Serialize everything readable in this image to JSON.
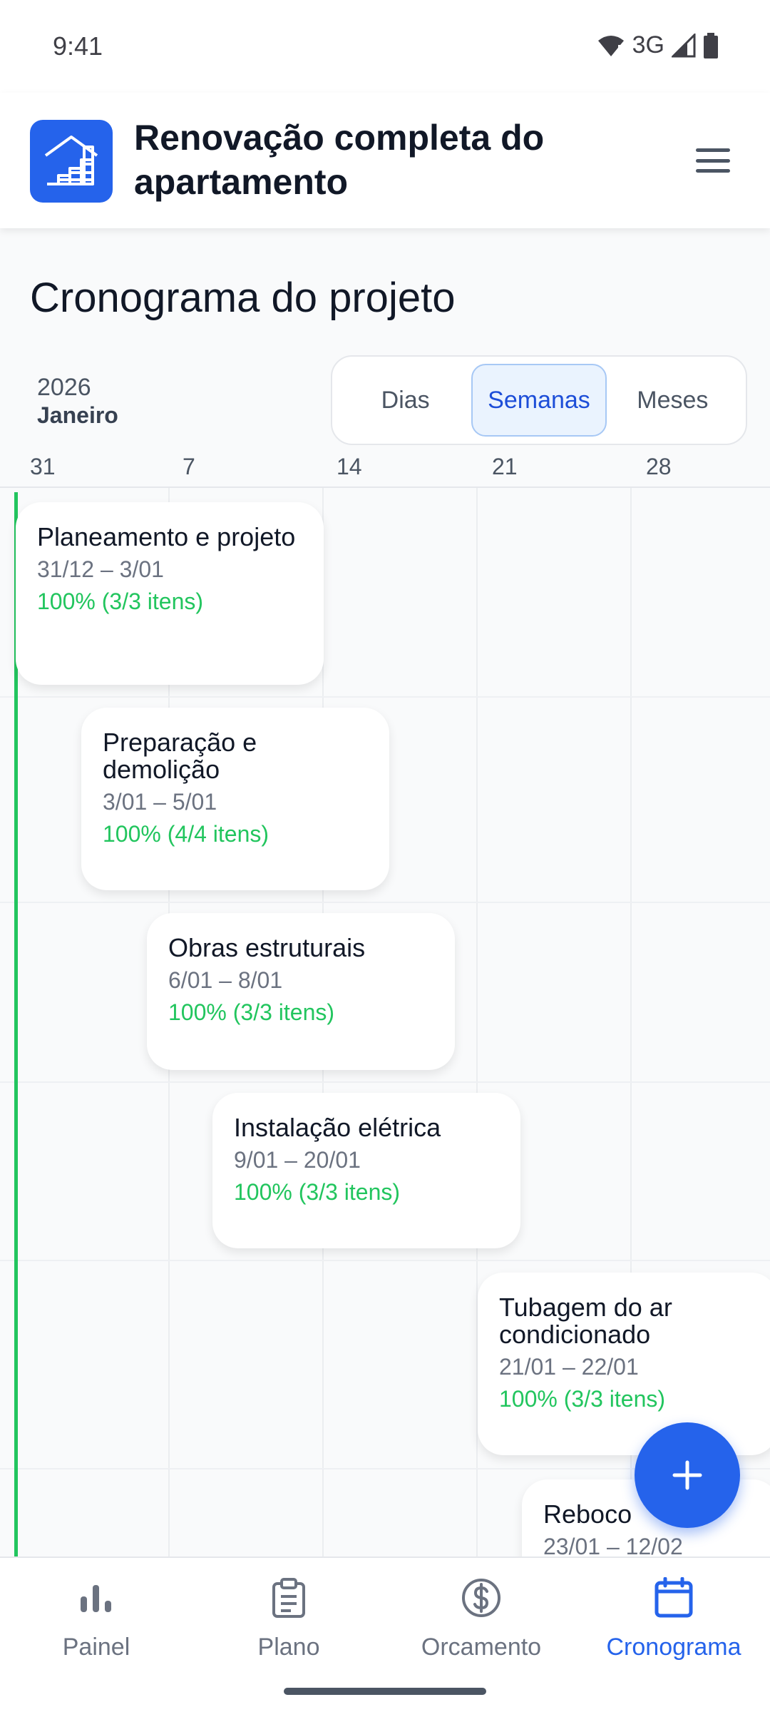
{
  "status_bar": {
    "time": "9:41",
    "network": "3G",
    "icons": [
      "wifi-icon",
      "signal-icon",
      "battery-icon"
    ]
  },
  "header": {
    "title": "Renovação completa do apartamento",
    "logo_icon": "building-stairs-icon",
    "menu_icon": "hamburger-menu-icon"
  },
  "schedule": {
    "title": "Cronograma do projeto",
    "year": "2026",
    "month": "Janeiro",
    "view_options": [
      "Dias",
      "Semanas",
      "Meses"
    ],
    "selected_view": "Semanas",
    "week_labels": [
      "31",
      "7",
      "14",
      "21",
      "28"
    ],
    "phases": [
      {
        "name": "Planeamento e projeto",
        "dates": "31/12 – 3/01",
        "progress": "100% (3/3 itens)",
        "percent": 100
      },
      {
        "name": "Preparação e demolição",
        "dates": "3/01 – 5/01",
        "progress": "100% (4/4 itens)",
        "percent": 100
      },
      {
        "name": "Obras estruturais",
        "dates": "6/01 – 8/01",
        "progress": "100% (3/3 itens)",
        "percent": 100
      },
      {
        "name": "Instalação elétrica",
        "dates": "9/01 – 20/01",
        "progress": "100% (3/3 itens)",
        "percent": 100
      },
      {
        "name": "Tubagem do ar condicionado",
        "dates": "21/01 – 22/01",
        "progress": "100% (3/3 itens)",
        "percent": 100
      },
      {
        "name": "Reboco",
        "dates": "23/01 – 12/02",
        "progress": "",
        "percent": null
      }
    ]
  },
  "fab": {
    "icon": "plus-icon"
  },
  "bottom_nav": {
    "items": [
      {
        "label": "Painel",
        "icon": "bar-chart-icon"
      },
      {
        "label": "Plano",
        "icon": "clipboard-icon"
      },
      {
        "label": "Orcamento",
        "icon": "dollar-circle-icon"
      },
      {
        "label": "Cronograma",
        "icon": "calendar-icon"
      }
    ],
    "active": "Cronograma"
  },
  "colors": {
    "primary": "#2563eb",
    "success": "#22c55e",
    "text": "#111827",
    "muted": "#6b7280"
  }
}
